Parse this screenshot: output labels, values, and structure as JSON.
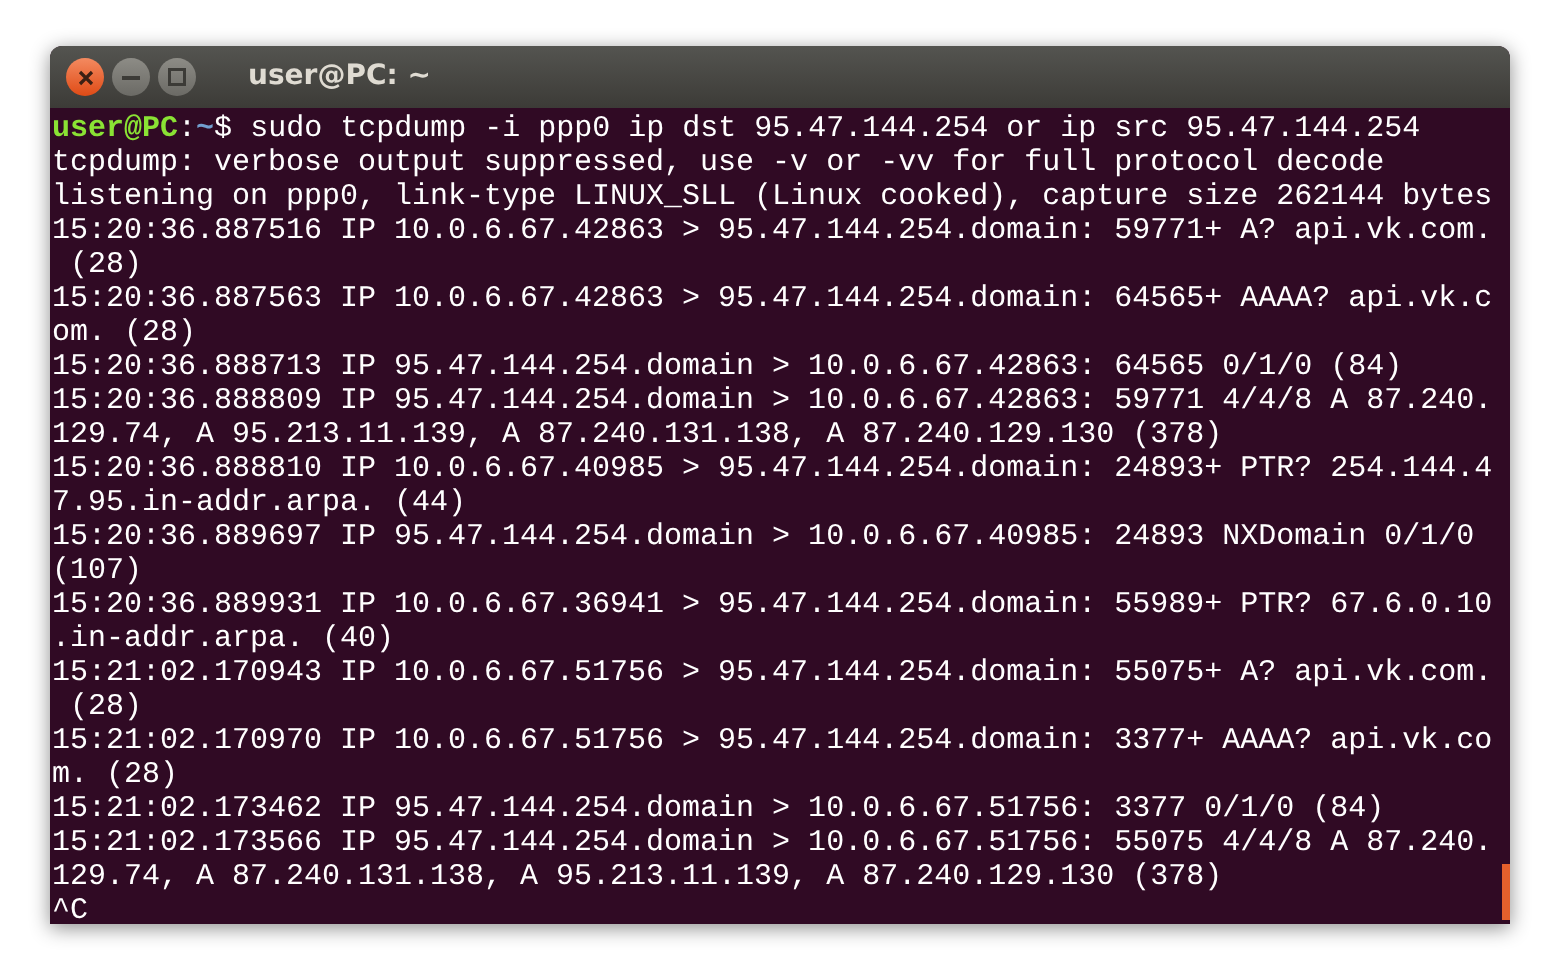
{
  "window": {
    "title": "user@PC: ~"
  },
  "terminal": {
    "lines": [
      {
        "kind": "prompt",
        "user_host": "user@PC",
        "separator": ":",
        "path": "~",
        "symbol": "$",
        "command": "sudo tcpdump -i ppp0 ip dst 95.47.144.254 or ip src 95.47.144.254"
      },
      {
        "kind": "output",
        "text": "tcpdump: verbose output suppressed, use -v or -vv for full protocol decode"
      },
      {
        "kind": "output",
        "text": "listening on ppp0, link-type LINUX_SLL (Linux cooked), capture size 262144 bytes"
      },
      {
        "kind": "output",
        "text": "15:20:36.887516 IP 10.0.6.67.42863 > 95.47.144.254.domain: 59771+ A? api.vk.com."
      },
      {
        "kind": "output",
        "text": " (28)"
      },
      {
        "kind": "output",
        "text": "15:20:36.887563 IP 10.0.6.67.42863 > 95.47.144.254.domain: 64565+ AAAA? api.vk.c"
      },
      {
        "kind": "output",
        "text": "om. (28)"
      },
      {
        "kind": "output",
        "text": "15:20:36.888713 IP 95.47.144.254.domain > 10.0.6.67.42863: 64565 0/1/0 (84)"
      },
      {
        "kind": "output",
        "text": "15:20:36.888809 IP 95.47.144.254.domain > 10.0.6.67.42863: 59771 4/4/8 A 87.240."
      },
      {
        "kind": "output",
        "text": "129.74, A 95.213.11.139, A 87.240.131.138, A 87.240.129.130 (378)"
      },
      {
        "kind": "output",
        "text": "15:20:36.888810 IP 10.0.6.67.40985 > 95.47.144.254.domain: 24893+ PTR? 254.144.4"
      },
      {
        "kind": "output",
        "text": "7.95.in-addr.arpa. (44)"
      },
      {
        "kind": "output",
        "text": "15:20:36.889697 IP 95.47.144.254.domain > 10.0.6.67.40985: 24893 NXDomain 0/1/0"
      },
      {
        "kind": "output",
        "text": "(107)"
      },
      {
        "kind": "output",
        "text": "15:20:36.889931 IP 10.0.6.67.36941 > 95.47.144.254.domain: 55989+ PTR? 67.6.0.10"
      },
      {
        "kind": "output",
        "text": ".in-addr.arpa. (40)"
      },
      {
        "kind": "output",
        "text": "15:21:02.170943 IP 10.0.6.67.51756 > 95.47.144.254.domain: 55075+ A? api.vk.com."
      },
      {
        "kind": "output",
        "text": " (28)"
      },
      {
        "kind": "output",
        "text": "15:21:02.170970 IP 10.0.6.67.51756 > 95.47.144.254.domain: 3377+ AAAA? api.vk.co"
      },
      {
        "kind": "output",
        "text": "m. (28)"
      },
      {
        "kind": "output",
        "text": "15:21:02.173462 IP 95.47.144.254.domain > 10.0.6.67.51756: 3377 0/1/0 (84)"
      },
      {
        "kind": "output",
        "text": "15:21:02.173566 IP 95.47.144.254.domain > 10.0.6.67.51756: 55075 4/4/8 A 87.240."
      },
      {
        "kind": "output",
        "text": "129.74, A 87.240.131.138, A 95.213.11.139, A 87.240.129.130 (378)"
      },
      {
        "kind": "output",
        "text": "^C"
      }
    ]
  }
}
